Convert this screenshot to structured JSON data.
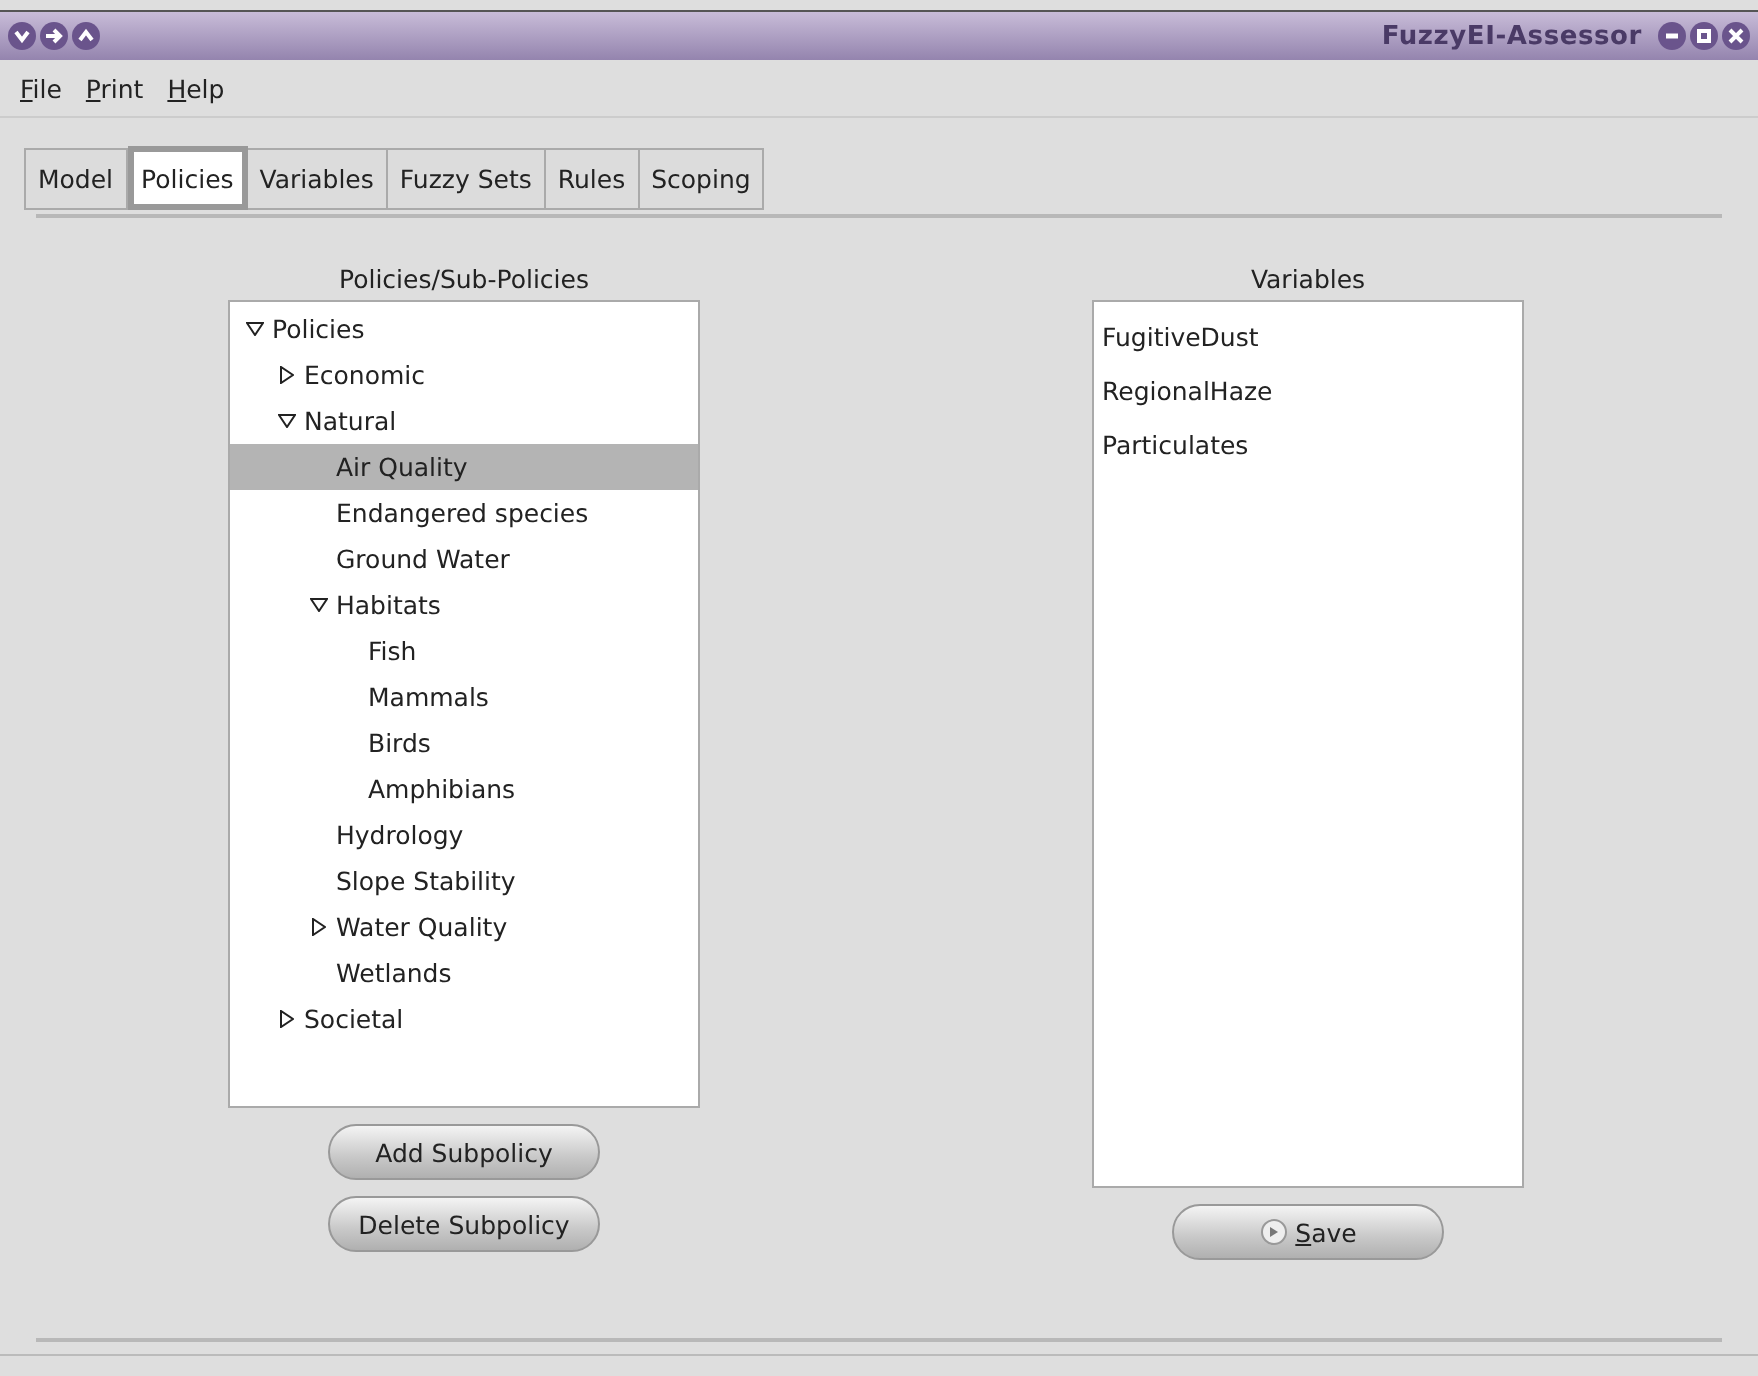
{
  "window": {
    "title": "FuzzyEI-Assessor"
  },
  "menu": [
    {
      "label": "File",
      "underline_first": true
    },
    {
      "label": "Print",
      "underline_first": true
    },
    {
      "label": "Help",
      "underline_first": true
    }
  ],
  "tabs": [
    {
      "label": "Model",
      "selected": false
    },
    {
      "label": "Policies",
      "selected": true
    },
    {
      "label": "Variables",
      "selected": false
    },
    {
      "label": "Fuzzy Sets",
      "selected": false
    },
    {
      "label": "Rules",
      "selected": false
    },
    {
      "label": "Scoping",
      "selected": false
    }
  ],
  "policies": {
    "title": "Policies/Sub-Policies",
    "tree": [
      {
        "label": "Policies",
        "expanded": true,
        "selected": false,
        "children": [
          {
            "label": "Economic",
            "expanded": false,
            "selected": false
          },
          {
            "label": "Natural",
            "expanded": true,
            "selected": false,
            "children": [
              {
                "label": "Air Quality",
                "selected": true
              },
              {
                "label": "Endangered species",
                "selected": false
              },
              {
                "label": "Ground Water",
                "selected": false
              },
              {
                "label": "Habitats",
                "expanded": true,
                "selected": false,
                "children": [
                  {
                    "label": "Fish",
                    "selected": false
                  },
                  {
                    "label": "Mammals",
                    "selected": false
                  },
                  {
                    "label": "Birds",
                    "selected": false
                  },
                  {
                    "label": "Amphibians",
                    "selected": false
                  }
                ]
              },
              {
                "label": "Hydrology",
                "selected": false
              },
              {
                "label": "Slope Stability",
                "selected": false
              },
              {
                "label": "Water Quality",
                "expanded": false,
                "selected": false
              },
              {
                "label": "Wetlands",
                "selected": false
              }
            ]
          },
          {
            "label": "Societal",
            "expanded": false,
            "selected": false
          }
        ]
      }
    ],
    "buttons": [
      "Add Subpolicy",
      "Delete Subpolicy"
    ]
  },
  "variables": {
    "title": "Variables",
    "items": [
      "FugitiveDust",
      "RegionalHaze",
      "Particulates"
    ],
    "save_button": {
      "label": "Save",
      "underline_first": true
    }
  }
}
